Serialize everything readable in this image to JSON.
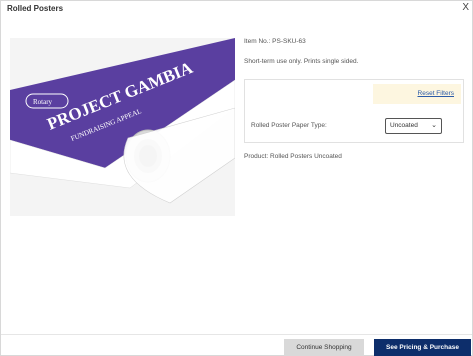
{
  "modal": {
    "title": "Rolled Posters",
    "close_glyph": "X"
  },
  "product": {
    "item_no": "Item No.: PS-SKU-63",
    "description": "Short-term use only. Prints single sided.",
    "image": {
      "banner_text": "PROJECT GAMBIA",
      "banner_subtext": "FUNDRAISING APPEAL",
      "logo_text": "Rotary",
      "banner_color": "#5a3fa0"
    },
    "summary": "Product: Rolled Posters Uncoated"
  },
  "filters": {
    "reset_label": "Reset Filters",
    "paper_type_label": "Rolled Poster Paper Type:",
    "paper_type_value": "Uncoated",
    "dropdown_icon": "chevron-down-icon"
  },
  "footer": {
    "continue_label": "Continue Shopping",
    "purchase_label": "See Pricing & Purchase"
  }
}
